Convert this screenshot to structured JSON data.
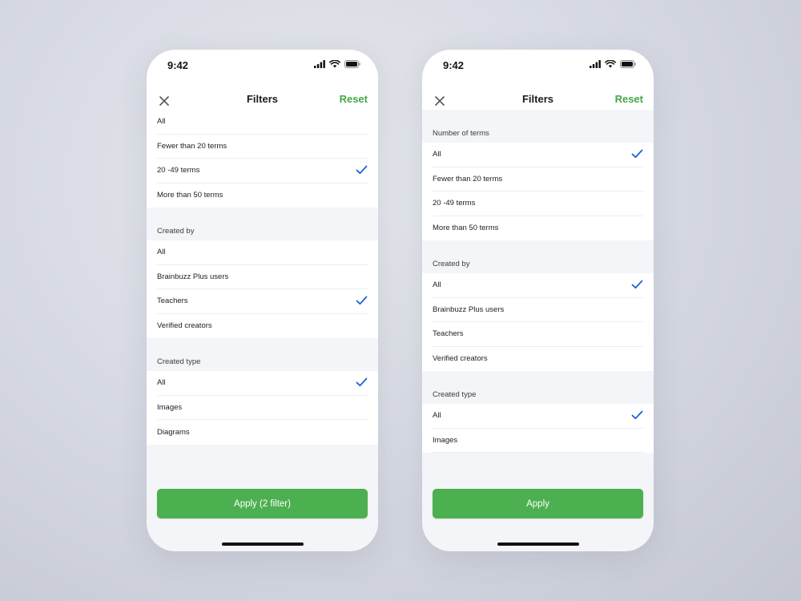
{
  "colors": {
    "accent": "#43a848",
    "apply_button": "#4caf50",
    "check": "#1f5fd6",
    "background": "#f4f5f8"
  },
  "phones": [
    {
      "status_time": "9:42",
      "title": "Filters",
      "reset_label": "Reset",
      "apply_label": "Apply (2 filter)",
      "sections": [
        {
          "items": [
            {
              "label": "All",
              "selected": false
            },
            {
              "label": "Fewer than 20 terms",
              "selected": false
            },
            {
              "label": "20 -49 terms",
              "selected": true
            },
            {
              "label": "More than 50 terms",
              "selected": false
            }
          ]
        },
        {
          "header": "Created by",
          "items": [
            {
              "label": "All",
              "selected": false
            },
            {
              "label": "Brainbuzz Plus users",
              "selected": false
            },
            {
              "label": "Teachers",
              "selected": true
            },
            {
              "label": "Verified creators",
              "selected": false
            }
          ]
        },
        {
          "header": "Created type",
          "items": [
            {
              "label": "All",
              "selected": true
            },
            {
              "label": "Images",
              "selected": false
            },
            {
              "label": "Diagrams",
              "selected": false
            }
          ]
        }
      ]
    },
    {
      "status_time": "9:42",
      "title": "Filters",
      "reset_label": "Reset",
      "apply_label": "Apply",
      "sections": [
        {
          "header": "Number of terms",
          "items": [
            {
              "label": "All",
              "selected": true
            },
            {
              "label": "Fewer than 20 terms",
              "selected": false
            },
            {
              "label": "20 -49 terms",
              "selected": false
            },
            {
              "label": "More than 50 terms",
              "selected": false
            }
          ]
        },
        {
          "header": "Created by",
          "items": [
            {
              "label": "All",
              "selected": true
            },
            {
              "label": "Brainbuzz Plus users",
              "selected": false
            },
            {
              "label": "Teachers",
              "selected": false
            },
            {
              "label": "Verified creators",
              "selected": false
            }
          ]
        },
        {
          "header": "Created type",
          "items": [
            {
              "label": "All",
              "selected": true
            },
            {
              "label": "Images",
              "selected": false
            }
          ]
        }
      ]
    }
  ]
}
